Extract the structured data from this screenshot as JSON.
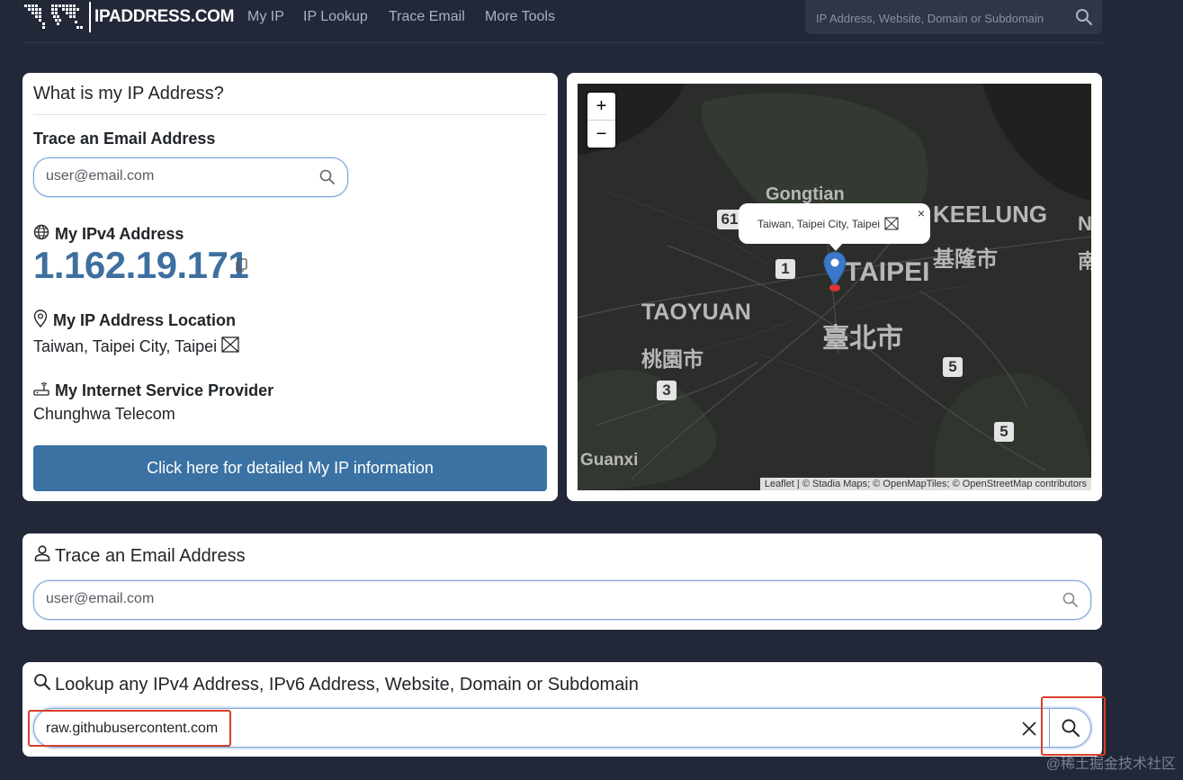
{
  "header": {
    "logo_text": "IPADDRESS.COM",
    "nav": [
      "My IP",
      "IP Lookup",
      "Trace Email",
      "More Tools"
    ],
    "search_placeholder": "IP Address, Website, Domain or Subdomain"
  },
  "left_card": {
    "title": "What is my IP Address?",
    "trace_email_label": "Trace an Email Address",
    "email_placeholder": "user@email.com",
    "ipv4_label": "My IPv4 Address",
    "ipv4_value": "1.162.19.171",
    "location_label": "My IP Address Location",
    "location_value": "Taiwan, Taipei City, Taipei",
    "isp_label": "My Internet Service Provider",
    "isp_value": "Chunghwa Telecom",
    "cta_label": "Click here for detailed My IP information"
  },
  "map": {
    "zoom_in": "+",
    "zoom_out": "−",
    "popup_text": "Taiwan, Taipei City, Taipei",
    "popup_close": "×",
    "labels": {
      "gongtian": "Gongtian",
      "keelung": "KEELUNG",
      "keelung_zh": "基隆市",
      "taipei": "TAIPEI",
      "taipei_zh": "臺北市",
      "taoyuan": "TAOYUAN",
      "taoyuan_zh": "桃園市",
      "guanxi": "Guanxi",
      "n_edge": "N",
      "nan_edge": "南"
    },
    "shields": [
      "61",
      "1",
      "3",
      "5",
      "5"
    ],
    "attribution": {
      "leaflet": "Leaflet",
      "rest": " | © Stadia Maps; © OpenMapTiles; © OpenStreetMap contributors"
    }
  },
  "email_card": {
    "title": "Trace an Email Address",
    "placeholder": "user@email.com"
  },
  "lookup_card": {
    "title": "Lookup any IPv4 Address, IPv6 Address, Website, Domain or Subdomain",
    "input_value": "raw.githubusercontent.com"
  },
  "watermark": "@稀土掘金技术社区",
  "colors": {
    "background": "#222838",
    "accent_blue": "#3b72a3",
    "ip_blue": "#3d6f9f",
    "annotation_red": "#d8402c"
  }
}
